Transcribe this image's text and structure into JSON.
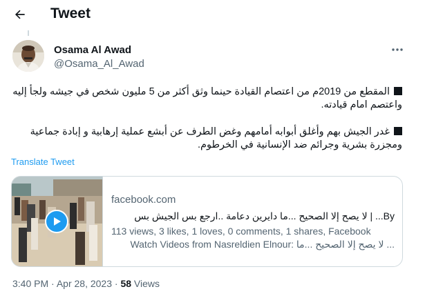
{
  "header": {
    "title": "Tweet"
  },
  "icons": {
    "back": "arrow-left-icon",
    "more": "more-horizontal-icon",
    "play": "play-icon"
  },
  "author": {
    "name": "Osama Al Awad",
    "handle": "@Osama_Al_Awad"
  },
  "tweet": {
    "paragraph1": "المقطع من 2019م من اعتصام القيادة حينما وثق أكثر من 5 مليون شخص في جيشه ولجأ إليه واعتصم امام قيادته.",
    "paragraph2": "غدر الجيش بهم وأغلق أبوابه أمامهم وغض الطرف عن أبشع عملية إرهابية و إبادة جماعية ومجزرة بشرية وجرائم ضد الإنسانية في الخرطوم.",
    "translate_label": "Translate Tweet"
  },
  "card": {
    "domain": "facebook.com",
    "title": "By... | لا يصح إلا الصحيح ...ما دايرين دعامة ..ارجع بس الجيش بس",
    "desc_line1": "113 views, 3 likes, 1 loves, 0 comments, 1 shares, Facebook",
    "desc_line2": "Watch Videos from Nasreldien Elnour: لا يصح إلا الصحيح ...ما ..."
  },
  "meta": {
    "time": "3:40 PM",
    "separator": "·",
    "date": "Apr 28, 2023",
    "views_count": "58",
    "views_label": "Views"
  },
  "colors": {
    "accent": "#1d9bf0",
    "text": "#0f1419",
    "secondary": "#536471",
    "border": "#cfd9de"
  }
}
